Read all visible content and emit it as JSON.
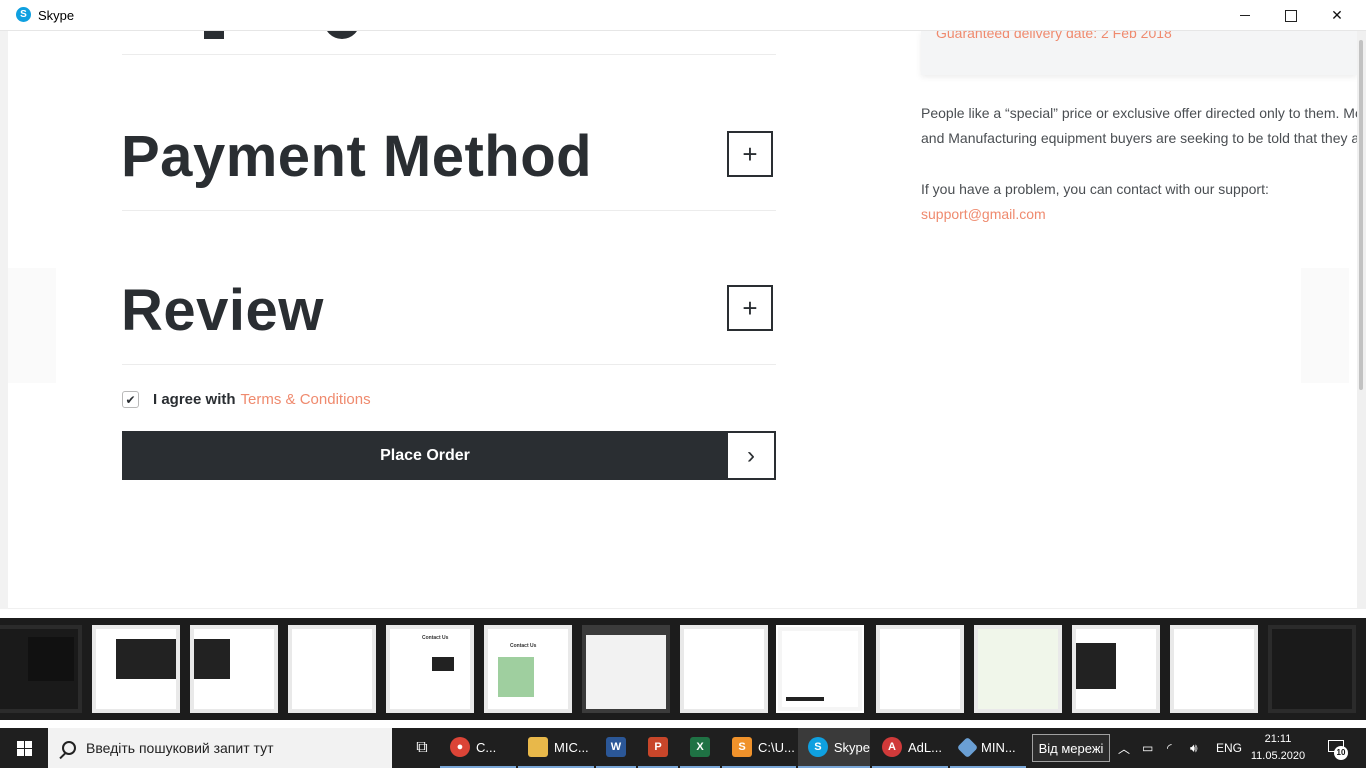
{
  "window": {
    "title": "Skype",
    "logo": "skype-icon"
  },
  "page": {
    "sections": [
      {
        "title": "Payment Method",
        "toggle": "+"
      },
      {
        "title": "Review",
        "toggle": "+"
      }
    ],
    "agree": {
      "checked": true,
      "text": "I agree with",
      "link": "Terms & Conditions"
    },
    "place_order": {
      "label": "Place Order",
      "arrow": "›"
    },
    "summary": {
      "delivery": "Guaranteed delivery date: 2 Feb 2018"
    },
    "info_lines": [
      "People like a “special” price or exclusive offer directed only to them. Mo",
      "and Manufacturing equipment buyers are seeking to be told that they a",
      "If you have a problem, you can contact with our support:"
    ],
    "support_email": "support@gmail.com"
  },
  "thumbnails": [
    {
      "label": "",
      "style": "mixed"
    },
    {
      "label": "",
      "style": "mixed"
    },
    {
      "label": "",
      "style": "mixed"
    },
    {
      "label": "",
      "style": "light"
    },
    {
      "label": "Contact Us",
      "style": "light"
    },
    {
      "label": "Contact Us",
      "style": "light"
    },
    {
      "label": "",
      "style": "photo"
    },
    {
      "label": "",
      "style": "light"
    },
    {
      "label": "",
      "style": "active"
    },
    {
      "label": "",
      "style": "light"
    },
    {
      "label": "",
      "style": "light"
    },
    {
      "label": "",
      "style": "mixed"
    },
    {
      "label": "",
      "style": "light"
    },
    {
      "label": "",
      "style": "dark"
    }
  ],
  "taskbar": {
    "search_placeholder": "Введіть пошуковий запит тут",
    "items": [
      {
        "label": "C...",
        "icon": "chrome-icon",
        "color": "#db4437"
      },
      {
        "label": "MIC...",
        "icon": "folder-icon",
        "color": "#e8b84a"
      },
      {
        "label": "",
        "icon": "word-icon",
        "color": "#2b5797"
      },
      {
        "label": "",
        "icon": "powerpoint-icon",
        "color": "#c8462a"
      },
      {
        "label": "",
        "icon": "excel-icon",
        "color": "#1f7244"
      },
      {
        "label": "C:\\U...",
        "icon": "sublime-icon",
        "color": "#f0922b"
      },
      {
        "label": "Skype",
        "icon": "skype-icon",
        "color": "#0fa0e0"
      },
      {
        "label": "AdL...",
        "icon": "adlock-icon",
        "color": "#d03a3a"
      },
      {
        "label": "MIN...",
        "icon": "git-icon",
        "color": "#6a9fd4"
      }
    ],
    "tooltip": "Від мережі",
    "tray": {
      "language": "ENG"
    },
    "clock": {
      "time": "21:11",
      "date": "11.05.2020"
    },
    "notifications": "10"
  }
}
